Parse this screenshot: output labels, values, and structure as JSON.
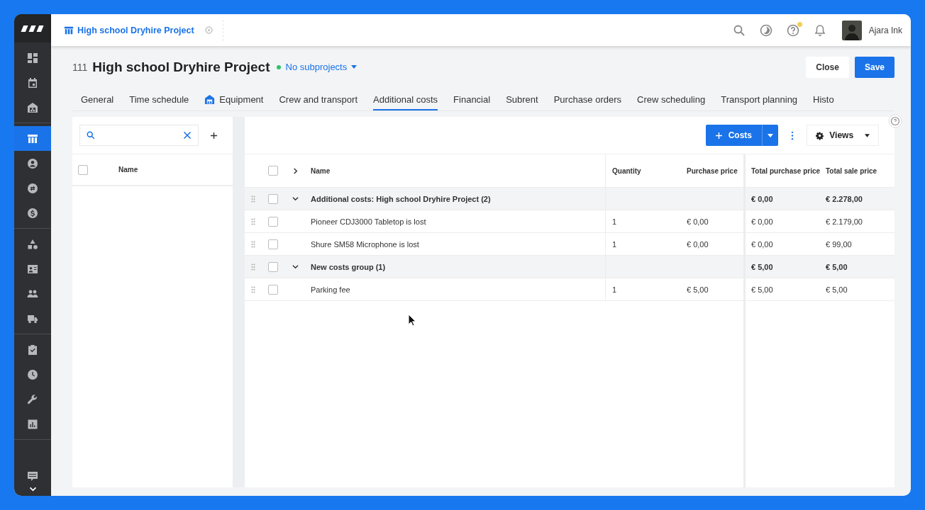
{
  "app_tab": {
    "label": "High school Dryhire Project"
  },
  "topbar": {
    "user_name": "Ajara Ink",
    "help_notice": true
  },
  "sidebar": {
    "groups": [
      [
        {
          "kind": "dashboard",
          "selected": false
        },
        {
          "kind": "calendar",
          "selected": false
        },
        {
          "kind": "warehouse",
          "selected": false
        }
      ],
      [
        {
          "kind": "project",
          "selected": true
        },
        {
          "kind": "person",
          "selected": false
        },
        {
          "kind": "exchange",
          "selected": false
        },
        {
          "kind": "dollar",
          "selected": false
        }
      ],
      [
        {
          "kind": "shapes",
          "selected": false
        },
        {
          "kind": "contact-card",
          "selected": false
        },
        {
          "kind": "people",
          "selected": false
        },
        {
          "kind": "truck",
          "selected": false
        }
      ],
      [
        {
          "kind": "task",
          "selected": false
        },
        {
          "kind": "clock",
          "selected": false
        },
        {
          "kind": "wrench",
          "selected": false
        },
        {
          "kind": "chart",
          "selected": false
        }
      ]
    ]
  },
  "header": {
    "number": "111",
    "title": "High school Dryhire Project",
    "subprojects": "No subprojects",
    "buttons": [
      {
        "label": "Close",
        "kind": "secondary"
      },
      {
        "label": "Save",
        "kind": "primary"
      }
    ]
  },
  "tabs": [
    {
      "label": "General",
      "selected": false
    },
    {
      "label": "Time schedule",
      "selected": false
    },
    {
      "label": "Equipment",
      "selected": false,
      "icon": true
    },
    {
      "label": "Crew and transport",
      "selected": false
    },
    {
      "label": "Additional costs",
      "selected": true
    },
    {
      "label": "Financial",
      "selected": false
    },
    {
      "label": "Subrent",
      "selected": false
    },
    {
      "label": "Purchase orders",
      "selected": false
    },
    {
      "label": "Crew scheduling",
      "selected": false
    },
    {
      "label": "Transport planning",
      "selected": false
    },
    {
      "label": "Histo",
      "selected": false
    }
  ],
  "left_panel": {
    "column": "Name",
    "checked": false
  },
  "toolbar": {
    "add_label": "Costs",
    "views_label": "Views"
  },
  "table": {
    "header_checked": false,
    "columns": [
      "Name",
      "Quantity",
      "Purchase price",
      "Total purchase price",
      "Total sale price"
    ],
    "rows": [
      {
        "kind": "group",
        "checked": false,
        "expanded": true,
        "name": "Additional costs: High school Dryhire Project (2)",
        "quantity": "",
        "purchase_price": "",
        "total_purchase": "€ 0,00",
        "total_sale": "€ 2.278,00"
      },
      {
        "kind": "item",
        "checked": false,
        "name": "Pioneer CDJ3000 Tabletop is lost",
        "quantity": "1",
        "purchase_price": "€ 0,00",
        "total_purchase": "€ 0,00",
        "total_sale": "€ 2.179,00"
      },
      {
        "kind": "item",
        "checked": false,
        "name": "Shure SM58 Microphone is lost",
        "quantity": "1",
        "purchase_price": "€ 0,00",
        "total_purchase": "€ 0,00",
        "total_sale": "€ 99,00"
      },
      {
        "kind": "group",
        "checked": false,
        "expanded": true,
        "name": "New costs group (1)",
        "quantity": "",
        "purchase_price": "",
        "total_purchase": "€ 5,00",
        "total_sale": "€ 5,00"
      },
      {
        "kind": "item",
        "checked": false,
        "name": "Parking fee",
        "quantity": "1",
        "purchase_price": "€ 5,00",
        "total_purchase": "€ 5,00",
        "total_sale": "€ 5,00"
      }
    ]
  }
}
